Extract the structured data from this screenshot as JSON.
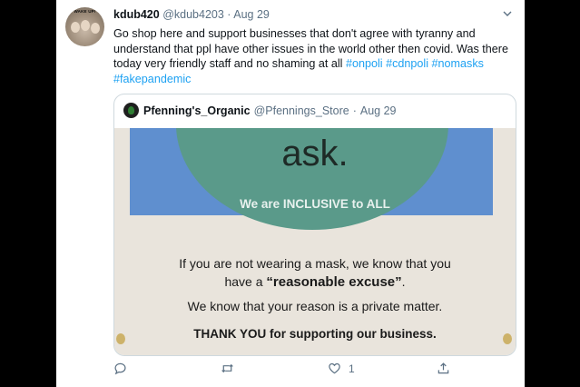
{
  "tweet": {
    "display_name": "kdub420",
    "handle": "@kdub4203",
    "separator": "·",
    "date": "Aug 29",
    "avatar_text": "WAKE UP!",
    "text_prefix": "Go shop here and support businesses that don't agree with tyranny and understand that ppl have other issues in the world other then covid. Was there today very friendly staff and no shaming at all",
    "hashtags": [
      "#onpoli",
      "#cdnpoli",
      "#nomasks",
      "#fakepandemic"
    ]
  },
  "quoted": {
    "display_name": "Pfenning's_Organic",
    "handle": "@Pfennings_Store",
    "separator": "·",
    "date": "Aug 29",
    "sign": {
      "big_word": "ask.",
      "inclusive": "We are INCLUSIVE to ALL",
      "line1": "If you are not wearing a mask, we know that you",
      "line2_pre": "have a ",
      "line2_bold": "“reasonable excuse”",
      "line2_post": ".",
      "line3": "We know that your reason is a private matter.",
      "line4": "THANK YOU for supporting our business."
    }
  },
  "actions": {
    "reply_icon": "reply-icon",
    "retweet_icon": "retweet-icon",
    "like_icon": "like-icon",
    "like_count": "1",
    "share_icon": "share-icon"
  },
  "colors": {
    "link": "#1da1f2",
    "muted": "#5b7083",
    "text": "#0f1419"
  }
}
